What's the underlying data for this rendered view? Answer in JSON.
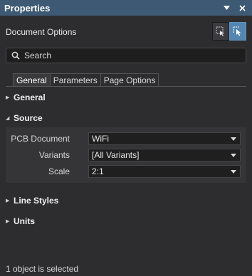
{
  "panel": {
    "title": "Properties",
    "pin_icon": "chevron-down-icon",
    "close_icon": "close-icon"
  },
  "header": {
    "doc_options": "Document Options",
    "filter_buttons": [
      {
        "icon": "select-filter-icon",
        "active": false
      },
      {
        "icon": "cursor-select-icon",
        "active": true
      }
    ]
  },
  "search": {
    "placeholder": "Search",
    "icon": "search-icon"
  },
  "tabs": [
    {
      "label": "General",
      "active": true
    },
    {
      "label": "Parameters",
      "active": false
    },
    {
      "label": "Page Options",
      "active": false
    }
  ],
  "sections": {
    "general": "General",
    "source": "Source",
    "line_styles": "Line Styles",
    "units": "Units"
  },
  "source": {
    "pcb_document": {
      "label": "PCB Document",
      "value": "WiFi"
    },
    "variants": {
      "label": "Variants",
      "value": "[All Variants]"
    },
    "scale": {
      "label": "Scale",
      "value": "2:1"
    }
  },
  "status": "1 object is selected",
  "colors": {
    "title_bar": "#3e5974",
    "panel_bg": "#2d2d30",
    "accent": "#5486b1"
  }
}
